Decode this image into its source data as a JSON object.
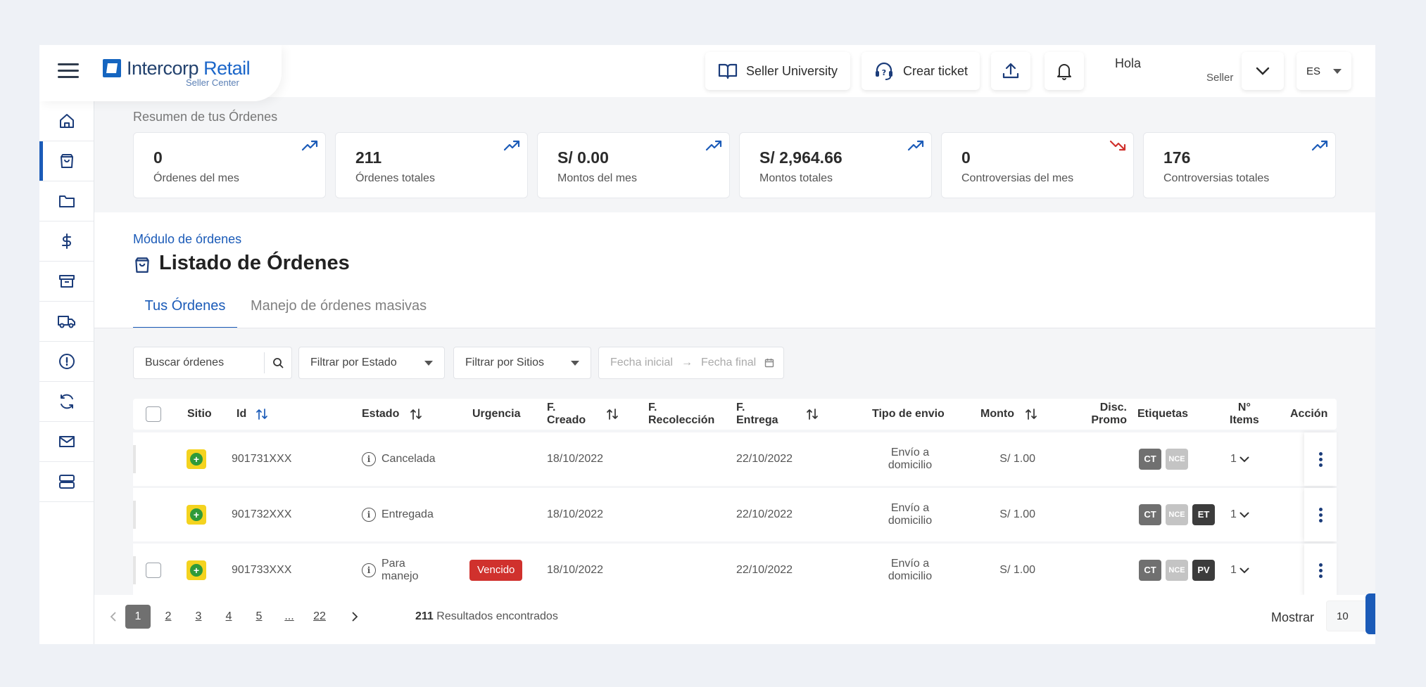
{
  "brand": {
    "name_a": "Intercorp",
    "name_b": " Retail",
    "subtitle": "Seller Center"
  },
  "header": {
    "university_label": "Seller University",
    "ticket_label": "Crear ticket",
    "greeting": "Hola",
    "role": "Seller",
    "language": "ES"
  },
  "sidebar": {
    "items": [
      "home-icon",
      "shopping-bag-icon",
      "folder-icon",
      "dollar-icon",
      "archive-box-icon",
      "truck-icon",
      "alert-circle-icon",
      "refresh-icon",
      "mail-icon",
      "server-icon"
    ],
    "active_index": 1
  },
  "summary": {
    "title": "Resumen de tus Órdenes",
    "cards": [
      {
        "value": "0",
        "label": "Órdenes del mes",
        "trend": "up"
      },
      {
        "value": "211",
        "label": "Órdenes totales",
        "trend": "up"
      },
      {
        "value": "S/ 0.00",
        "label": "Montos del mes",
        "trend": "up"
      },
      {
        "value": "S/ 2,964.66",
        "label": "Montos totales",
        "trend": "up"
      },
      {
        "value": "0",
        "label": "Controversias del mes",
        "trend": "down"
      },
      {
        "value": "176",
        "label": "Controversias totales",
        "trend": "up"
      }
    ]
  },
  "main": {
    "breadcrumb": "Módulo de órdenes",
    "title": "Listado de Órdenes",
    "tabs": [
      {
        "label": "Tus Órdenes"
      },
      {
        "label": "Manejo de órdenes masivas"
      }
    ]
  },
  "filters": {
    "search_placeholder": "Buscar órdenes",
    "estado": "Filtrar por Estado",
    "sitios": "Filtrar por Sitios",
    "date_start": "Fecha inicial",
    "date_end": "Fecha final"
  },
  "table": {
    "columns": {
      "sitio": "Sitio",
      "id": "Id",
      "estado": "Estado",
      "urgencia": "Urgencia",
      "creado_a": "F.",
      "creado_b": "Creado",
      "recoleccion_a": "F.",
      "recoleccion_b": "Recolección",
      "entrega_a": "F.",
      "entrega_b": "Entrega",
      "tipo_envio": "Tipo de envio",
      "monto": "Monto",
      "disc_a": "Disc.",
      "disc_b": "Promo",
      "etiquetas": "Etiquetas",
      "items_a": "N°",
      "items_b": "Items",
      "accion": "Acción"
    },
    "rows": [
      {
        "id": "901731XXX",
        "estado_a": "Cancelada",
        "estado_b": "",
        "urgencia": "",
        "creado": "18/10/2022",
        "entrega": "22/10/2022",
        "envio_a": "Envío a",
        "envio_b": "domicilio",
        "monto": "S/ 1.00",
        "tags": [
          "CT",
          "NCE"
        ],
        "items": "1",
        "has_checkbox": false
      },
      {
        "id": "901732XXX",
        "estado_a": "Entregada",
        "estado_b": "",
        "urgencia": "",
        "creado": "18/10/2022",
        "entrega": "22/10/2022",
        "envio_a": "Envío a",
        "envio_b": "domicilio",
        "monto": "S/ 1.00",
        "tags": [
          "CT",
          "NCE",
          "ET"
        ],
        "items": "1",
        "has_checkbox": false
      },
      {
        "id": "901733XXX",
        "estado_a": "Para",
        "estado_b": "manejo",
        "urgencia": "Vencido",
        "creado": "18/10/2022",
        "entrega": "22/10/2022",
        "envio_a": "Envío a",
        "envio_b": "domicilio",
        "monto": "S/ 1.00",
        "tags": [
          "CT",
          "NCE",
          "PV"
        ],
        "items": "1",
        "has_checkbox": true
      }
    ]
  },
  "pagination": {
    "pages": [
      "1",
      "2",
      "3",
      "4",
      "5",
      "...",
      "22"
    ],
    "current": "1",
    "results_count": "211",
    "results_label": " Resultados encontrados",
    "show_label": "Mostrar",
    "page_size": "10"
  },
  "colors": {
    "primary": "#1b5bb8",
    "danger": "#d0312d",
    "trend_up": "#1b5bb8",
    "trend_down": "#d0312d",
    "site_logo": "#f4d31f"
  }
}
